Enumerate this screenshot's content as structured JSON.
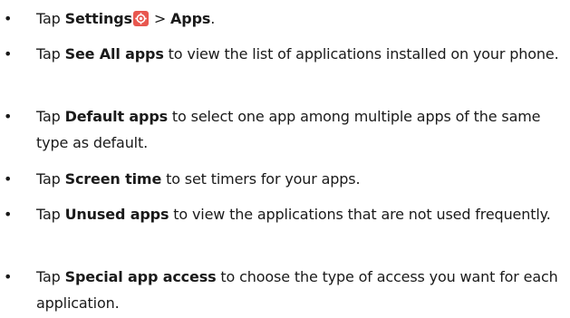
{
  "items": [
    {
      "prefix": "Tap ",
      "bold": "Settings",
      "icon": "settings-gear-icon",
      "sep": " > ",
      "bold2": "Apps",
      "suffix": "."
    },
    {
      "prefix": "Tap ",
      "bold": "See All apps",
      "suffix": " to view the list of applications installed on your phone."
    },
    {
      "prefix": "Tap ",
      "bold": "Default apps",
      "suffix": " to select one app among multiple apps of the same type as default."
    },
    {
      "prefix": "Tap ",
      "bold": "Screen time",
      "suffix": " to set timers for your apps."
    },
    {
      "prefix": "Tap ",
      "bold": "Unused apps",
      "suffix": " to view the applications that are not used frequently."
    },
    {
      "prefix": "Tap ",
      "bold": "Special app access",
      "suffix": " to choose the type of access you want for each application."
    }
  ],
  "bullet": "•",
  "colors": {
    "icon_bg": "#e8574f",
    "text": "#1a1a1a"
  }
}
